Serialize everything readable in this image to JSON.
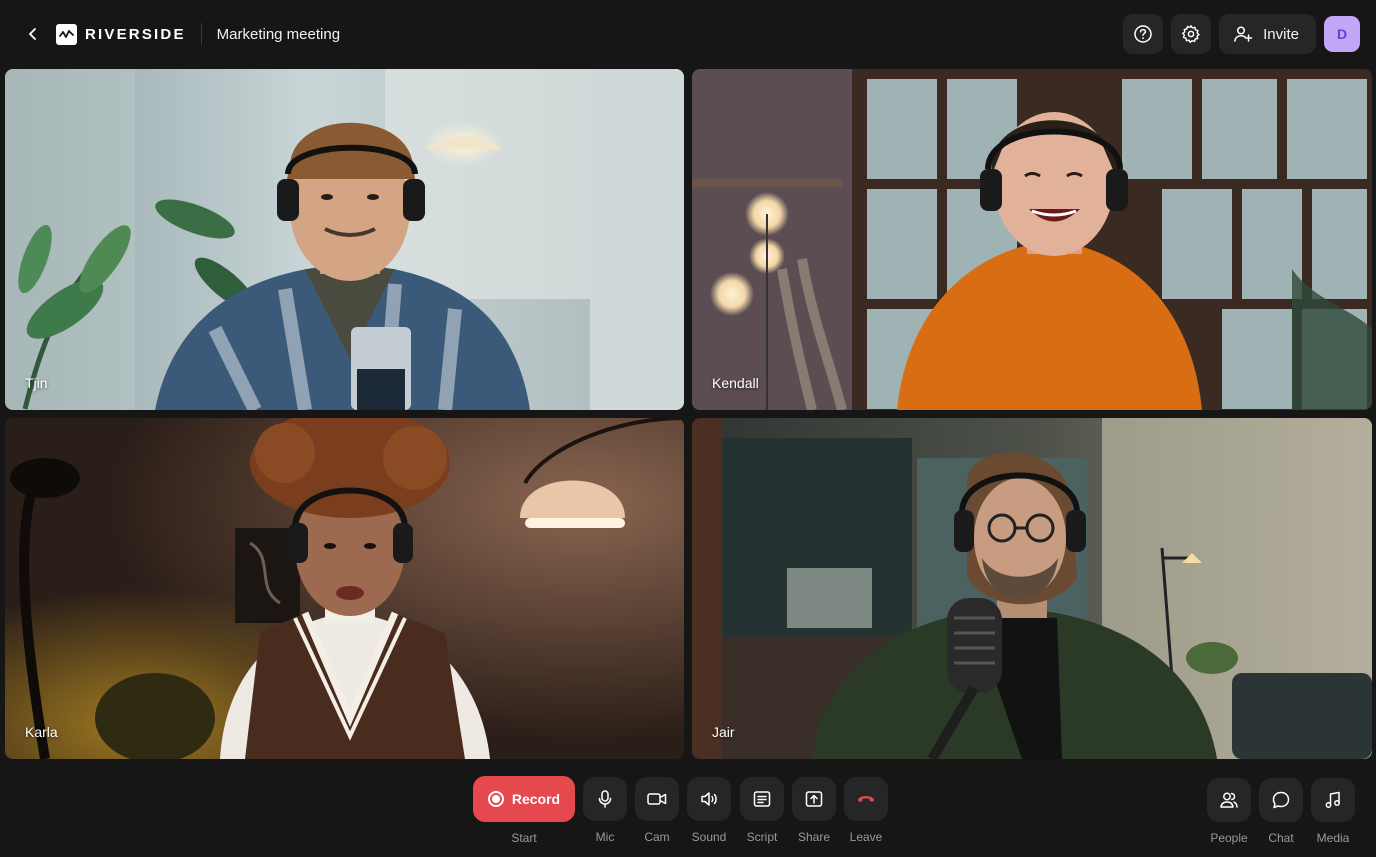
{
  "header": {
    "brand": "RIVERSIDE",
    "meeting_title": "Marketing meeting",
    "invite_label": "Invite",
    "avatar_initial": "D"
  },
  "participants": [
    {
      "name": "Tjin"
    },
    {
      "name": "Kendall"
    },
    {
      "name": "Karla"
    },
    {
      "name": "Jair"
    }
  ],
  "controls": {
    "record_label": "Record",
    "record_sub": "Start",
    "mic": "Mic",
    "cam": "Cam",
    "sound": "Sound",
    "script": "Script",
    "share": "Share",
    "leave": "Leave",
    "people": "People",
    "chat": "Chat",
    "media": "Media"
  },
  "colors": {
    "background": "#161616",
    "button": "#262626",
    "record": "#e5484d",
    "leave_icon": "#e5484d",
    "avatar_bg": "#c2a6f7"
  }
}
